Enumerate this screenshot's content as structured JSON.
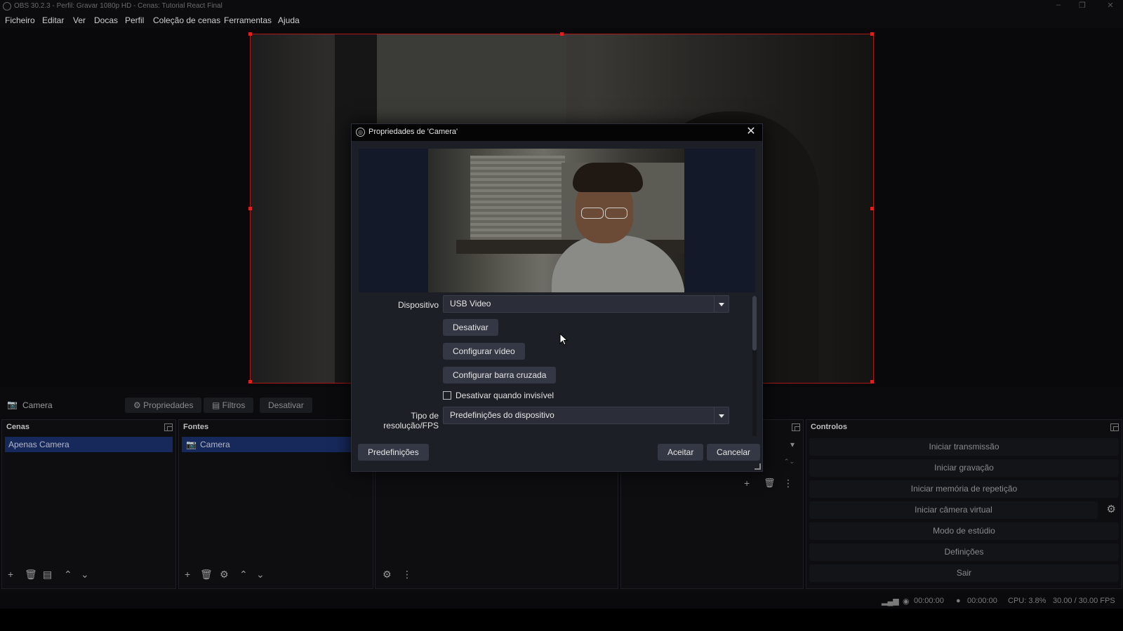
{
  "window": {
    "title": "OBS 30.2.3 - Perfil: Gravar 1080p HD - Cenas: Tutorial React Final"
  },
  "menu": {
    "items": [
      "Ficheiro",
      "Editar",
      "Ver",
      "Docas",
      "Perfil",
      "Coleção de cenas",
      "Ferramentas",
      "Ajuda"
    ]
  },
  "source_toolbar": {
    "selected_source": "Camera",
    "properties_label": "Propriedades",
    "filters_label": "Filtros",
    "disable_label": "Desativar"
  },
  "docks": {
    "scenes": {
      "title": "Cenas",
      "items": [
        "Apenas Camera"
      ]
    },
    "sources": {
      "title": "Fontes",
      "items": [
        "Camera"
      ]
    },
    "controls": {
      "title": "Controlos",
      "buttons": [
        "Iniciar transmissão",
        "Iniciar gravação",
        "Iniciar memória de repetição",
        "Iniciar câmera virtual",
        "Modo de estúdio",
        "Definições",
        "Sair"
      ]
    }
  },
  "status": {
    "stream_time": "00:00:00",
    "record_time": "00:00:00",
    "cpu": "CPU: 3.8%",
    "fps": "30.00 / 30.00 FPS"
  },
  "dialog": {
    "title": "Propriedades de 'Camera'",
    "device_label": "Dispositivo",
    "device_value": "USB Video",
    "deactivate_button": "Desativar",
    "configure_video_button": "Configurar vídeo",
    "configure_crossbar_button": "Configurar barra cruzada",
    "deactivate_when_invisible": "Desativar quando invisível",
    "deactivate_when_invisible_checked": false,
    "resolution_label": "Tipo de resolução/FPS",
    "resolution_value": "Predefinições do dispositivo",
    "presets_button": "Predefinições",
    "accept_button": "Aceitar",
    "cancel_button": "Cancelar"
  },
  "colors": {
    "accent": "#17295b",
    "canvas_border": "#b01818",
    "dialog_bg": "#1d1f26"
  }
}
